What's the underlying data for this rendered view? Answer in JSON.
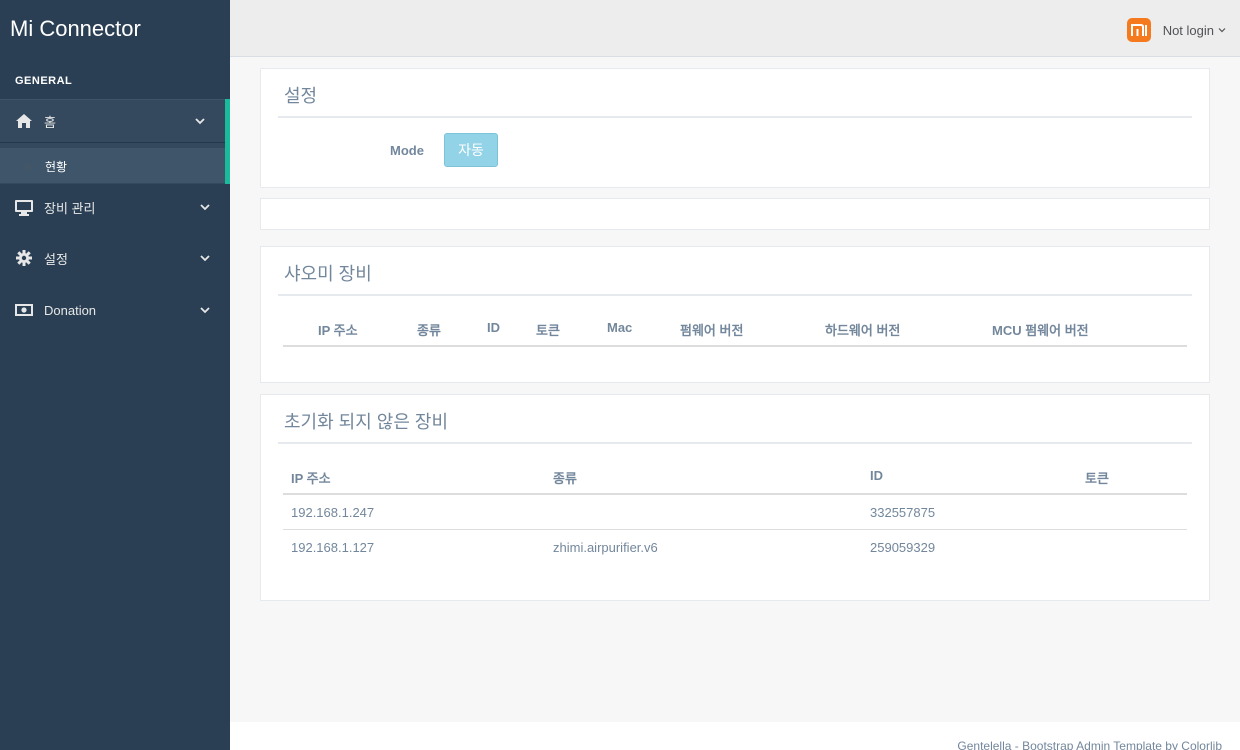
{
  "app": {
    "title": "Mi Connector"
  },
  "sidebar": {
    "section": "GENERAL",
    "items": [
      {
        "label": "홈",
        "icon": "home-icon"
      },
      {
        "label": "장비 관리",
        "icon": "desktop-icon"
      },
      {
        "label": "설정",
        "icon": "gear-icon"
      },
      {
        "label": "Donation",
        "icon": "money-icon"
      }
    ],
    "home_child": "현황"
  },
  "topbar": {
    "user": "Not login",
    "logo_text": "mi",
    "logo_color": "#F57A1E"
  },
  "settings_panel": {
    "title": "설정",
    "mode_label": "Mode",
    "mode_value": "자동"
  },
  "xiaomi_panel": {
    "title": "샤오미 장비",
    "columns": [
      "IP 주소",
      "종류",
      "ID",
      "토큰",
      "Mac",
      "펌웨어 버전",
      "하드웨어 버전",
      "MCU 펌웨어 버전"
    ]
  },
  "uninit_panel": {
    "title": "초기화 되지 않은 장비",
    "columns": [
      "IP 주소",
      "종류",
      "ID",
      "토큰"
    ],
    "rows": [
      {
        "ip": "192.168.1.247",
        "type": "",
        "id": "332557875",
        "token": ""
      },
      {
        "ip": "192.168.1.127",
        "type": "zhimi.airpurifier.v6",
        "id": "259059329",
        "token": ""
      }
    ]
  },
  "footer": {
    "text": "Gentelella - Bootstrap Admin Template by Colorlib"
  },
  "colors": {
    "sidebar": "#2A3F54",
    "accent": "#1ABB9C",
    "text": "#73879C"
  }
}
